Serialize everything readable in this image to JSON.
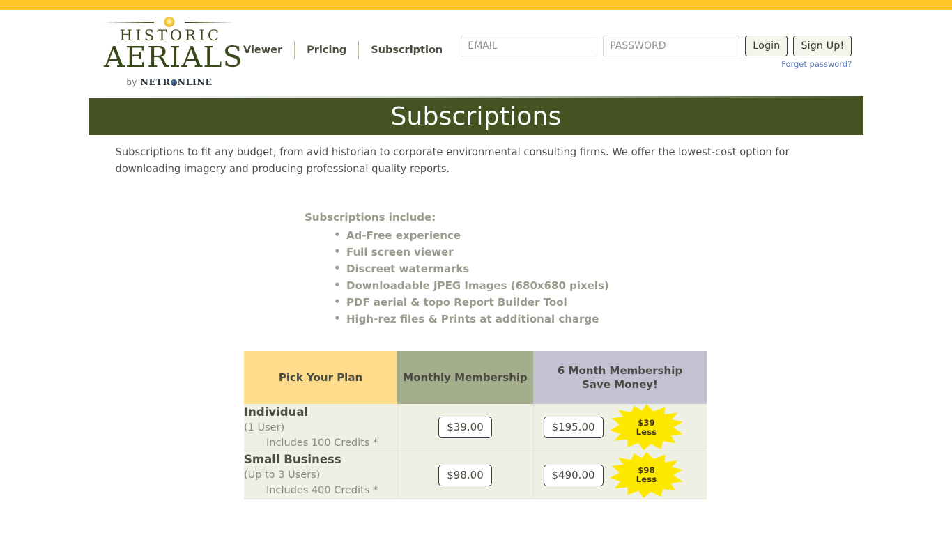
{
  "top_bar": {
    "color": "#ffc425"
  },
  "brand": {
    "line1": "HISTORIC",
    "line2": "AERIALS",
    "by_prefix": "by",
    "by_name_part1": "NETR",
    "by_name_part2": "NLINE",
    "ornament_icon": "gold-star-ornament-icon"
  },
  "nav": {
    "items": [
      {
        "label": "Viewer",
        "name": "nav-item-viewer"
      },
      {
        "label": "Pricing",
        "name": "nav-item-pricing"
      },
      {
        "label": "Subscription",
        "name": "nav-item-subscription"
      }
    ]
  },
  "auth": {
    "email_placeholder": "EMAIL",
    "email_value": "",
    "password_placeholder": "PASSWORD",
    "password_value": "",
    "login_label": "Login",
    "signup_label": "Sign Up!",
    "forget_label": "Forget password?"
  },
  "banner": {
    "title": "Subscriptions",
    "background": "#455222"
  },
  "intro": {
    "text": "Subscriptions to fit any budget, from avid historian to corporate environmental consulting firms. We offer the lowest-cost option for downloading imagery and producing professional quality reports."
  },
  "includes": {
    "title": "Subscriptions include:",
    "items": [
      "Ad-Free experience",
      "Full screen viewer",
      "Discreet watermarks",
      "Downloadable JPEG Images (680x680 pixels)",
      "PDF aerial & topo Report Builder Tool",
      "High-rez files & Prints at additional charge"
    ]
  },
  "pricing_table": {
    "headers": {
      "plan": "Pick Your Plan",
      "monthly": "Monthly Membership",
      "six_month_line1": "6 Month Membership",
      "six_month_line2": "Save Money!"
    },
    "header_colors": {
      "plan": "#fcdc8a",
      "monthly": "#a5ae8c",
      "six_month": "#c3c2d2"
    },
    "rows": [
      {
        "plan_name": "Individual",
        "plan_users": "(1 User)",
        "plan_credits": "Includes 100 Credits *",
        "monthly_price": "$39.00",
        "six_month_price": "$195.00",
        "badge_line1": "$39",
        "badge_line2": "Less"
      },
      {
        "plan_name": "Small Business",
        "plan_users": "(Up to 3 Users)",
        "plan_credits": "Includes 400 Credits *",
        "monthly_price": "$98.00",
        "six_month_price": "$490.00",
        "badge_line1": "$98",
        "badge_line2": "Less"
      }
    ]
  }
}
